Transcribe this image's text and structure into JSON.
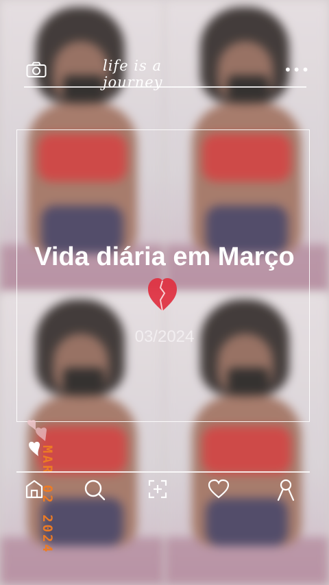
{
  "header": {
    "tagline": "life is a journey",
    "camera_icon": "camera-icon",
    "menu_icon": "more-dots-icon"
  },
  "card": {
    "title": "Vida diária em Março",
    "title_emoji": "broken-heart-emoji",
    "date": "03/2024"
  },
  "stamp": {
    "text": "MAR 02 2024",
    "color": "#ec7b25"
  },
  "nav": {
    "items": [
      {
        "icon": "home-icon"
      },
      {
        "icon": "search-icon"
      },
      {
        "icon": "add-icon"
      },
      {
        "icon": "heart-icon"
      },
      {
        "icon": "profile-icon"
      }
    ]
  },
  "colors": {
    "line": "#ffffff",
    "text": "#ffffff",
    "heart_red": "#e03040"
  }
}
